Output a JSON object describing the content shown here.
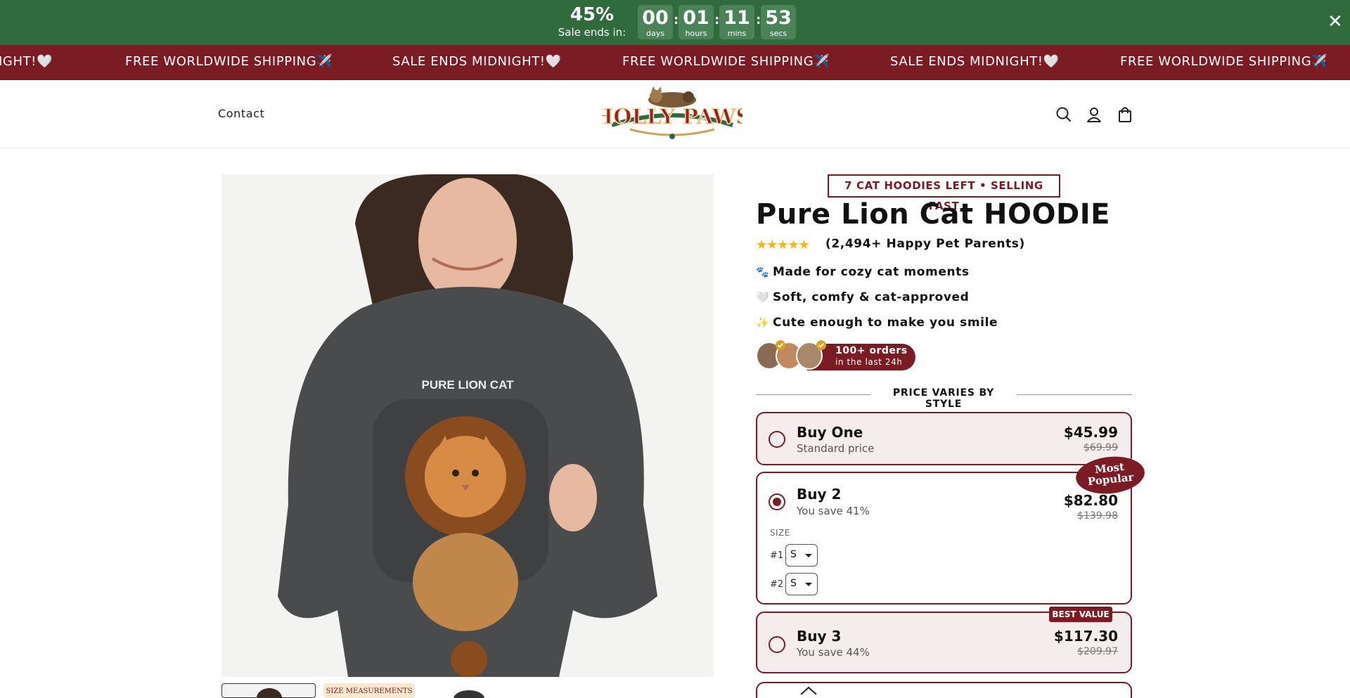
{
  "countdown": {
    "discount": "45%",
    "label": "Sale ends in:",
    "units": [
      {
        "value": "00",
        "label": "days"
      },
      {
        "value": "01",
        "label": "hours"
      },
      {
        "value": "11",
        "label": "mins"
      },
      {
        "value": "53",
        "label": "secs"
      }
    ],
    "separator": ":",
    "close_icon": "close-icon",
    "close_glyph": "✕",
    "bg_color": "#2f6b3c"
  },
  "marquee": {
    "items": [
      "IGHT!🤍",
      "FREE WORLDWIDE SHIPPING✈️",
      "SALE ENDS MIDNIGHT!🤍",
      "FREE WORLDWIDE SHIPPING✈️",
      "SALE ENDS MIDNIGHT!🤍",
      "FREE WORLDWIDE SHIPPING✈️"
    ],
    "bg_color": "#7b1c25"
  },
  "header": {
    "nav": {
      "contact": "Contact"
    },
    "logo_text": "HOLLY PAWS",
    "icons": [
      "search-icon",
      "account-icon",
      "cart-icon"
    ]
  },
  "gallery": {
    "print_text": "PURE LION CAT",
    "thumb_text": "SIZE MEASUREMENTS"
  },
  "product": {
    "stock_badge": "7 CAT HOODIES LEFT • SELLING FAST",
    "title": "Pure Lion Cat HOODIE",
    "stars": "★★★★★",
    "rating": 4.5,
    "review_text": "(2,494+ Happy Pet Parents)",
    "benefits": [
      {
        "emoji": "🐾",
        "text": "Made for cozy cat moments"
      },
      {
        "emoji": "🤍",
        "text": "Soft, comfy & cat-approved"
      },
      {
        "emoji": "✨",
        "text": "Cute enough to make you smile"
      }
    ],
    "orders": {
      "line1": "100+ orders",
      "line2": "in the last 24h"
    },
    "divider": "PRICE VARIES BY STYLE",
    "accent_color": "#7b1c25"
  },
  "offers": [
    {
      "title": "Buy One",
      "subtitle": "Standard price",
      "price": "$45.99",
      "compare": "$69.99",
      "selected": false
    },
    {
      "title": "Buy 2",
      "subtitle": "You save 41%",
      "price": "$82.80",
      "compare": "$139.98",
      "selected": true,
      "badge_line1": "Most",
      "badge_line2": "Popular",
      "size_label": "SIZE",
      "sizes": [
        {
          "label": "#1",
          "value": "S"
        },
        {
          "label": "#2",
          "value": "S"
        }
      ]
    },
    {
      "title": "Buy 3",
      "subtitle": "You save 44%",
      "price": "$117.30",
      "compare": "$209.97",
      "selected": false,
      "badge": "BEST VALUE"
    }
  ]
}
